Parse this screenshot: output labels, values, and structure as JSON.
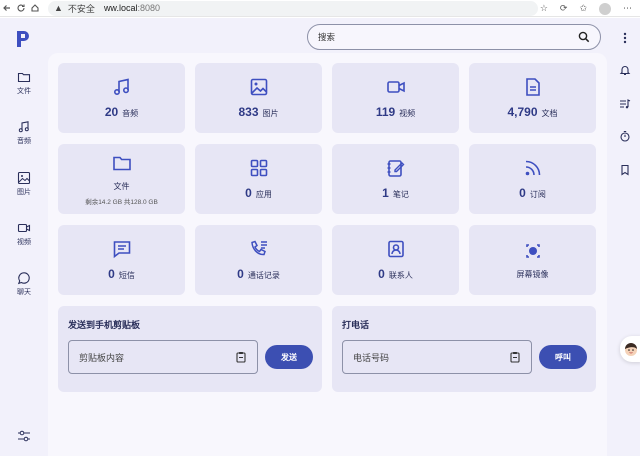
{
  "browser": {
    "warning": "不安全",
    "url_host": "ww.local",
    "url_port": ":8080"
  },
  "search": {
    "placeholder": "搜索"
  },
  "nav": [
    {
      "label": "文件",
      "icon": "folder-icon"
    },
    {
      "label": "音频",
      "icon": "music-icon"
    },
    {
      "label": "图片",
      "icon": "image-icon"
    },
    {
      "label": "视频",
      "icon": "video-icon"
    },
    {
      "label": "聊天",
      "icon": "chat-icon"
    }
  ],
  "tiles": [
    {
      "count": "20",
      "label": "音频",
      "icon": "music-icon"
    },
    {
      "count": "833",
      "label": "图片",
      "icon": "image-icon"
    },
    {
      "count": "119",
      "label": "视频",
      "icon": "video-icon"
    },
    {
      "count": "4,790",
      "label": "文档",
      "icon": "document-icon"
    },
    {
      "count": "",
      "label": "文件",
      "sub": "剩余14.2 GB 共128.0 GB",
      "icon": "folder-icon"
    },
    {
      "count": "0",
      "label": "应用",
      "icon": "apps-icon"
    },
    {
      "count": "1",
      "label": "笔记",
      "icon": "notes-icon"
    },
    {
      "count": "0",
      "label": "订阅",
      "icon": "rss-icon"
    },
    {
      "count": "0",
      "label": "短信",
      "icon": "sms-icon"
    },
    {
      "count": "0",
      "label": "通话记录",
      "icon": "call-log-icon"
    },
    {
      "count": "0",
      "label": "联系人",
      "icon": "contacts-icon"
    },
    {
      "count": "",
      "label": "屏幕镜像",
      "icon": "screen-mirror-icon"
    }
  ],
  "clipboard": {
    "title": "发送到手机剪贴板",
    "placeholder": "剪贴板内容",
    "button": "发送"
  },
  "call": {
    "title": "打电话",
    "placeholder": "电话号码",
    "button": "呼叫"
  },
  "colors": {
    "accent": "#3c4fb2",
    "tile_bg": "#e7e6f5",
    "page_bg": "#f2f1fb"
  }
}
